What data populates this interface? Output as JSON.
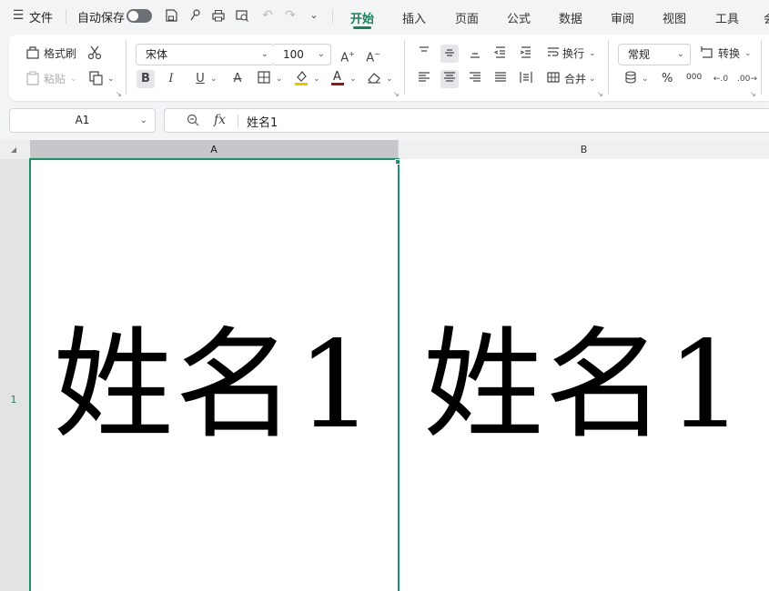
{
  "menu": {
    "file_label": "文件",
    "autosave_label": "自动保存",
    "tabs": [
      "开始",
      "插入",
      "页面",
      "公式",
      "数据",
      "审阅",
      "视图",
      "工具",
      "会"
    ]
  },
  "ribbon": {
    "format_painter": "格式刷",
    "paste": "粘贴",
    "font_name": "宋体",
    "font_size": "100",
    "bold": "B",
    "italic": "I",
    "underline": "U",
    "wrap_text": "换行",
    "merge": "合并",
    "number_format": "常规",
    "convert": "转换",
    "percent": "%",
    "thousands": "000"
  },
  "formula_bar": {
    "name_box": "A1",
    "fx": "fx",
    "content": "姓名1"
  },
  "sheet": {
    "columns": [
      "A",
      "B"
    ],
    "rows": [
      "1"
    ],
    "cells": {
      "A1": "姓名1",
      "B1": "姓名1"
    },
    "active_cell": "A1"
  },
  "colors": {
    "accent": "#1b7f5a",
    "selection": "#1f8f6a"
  }
}
